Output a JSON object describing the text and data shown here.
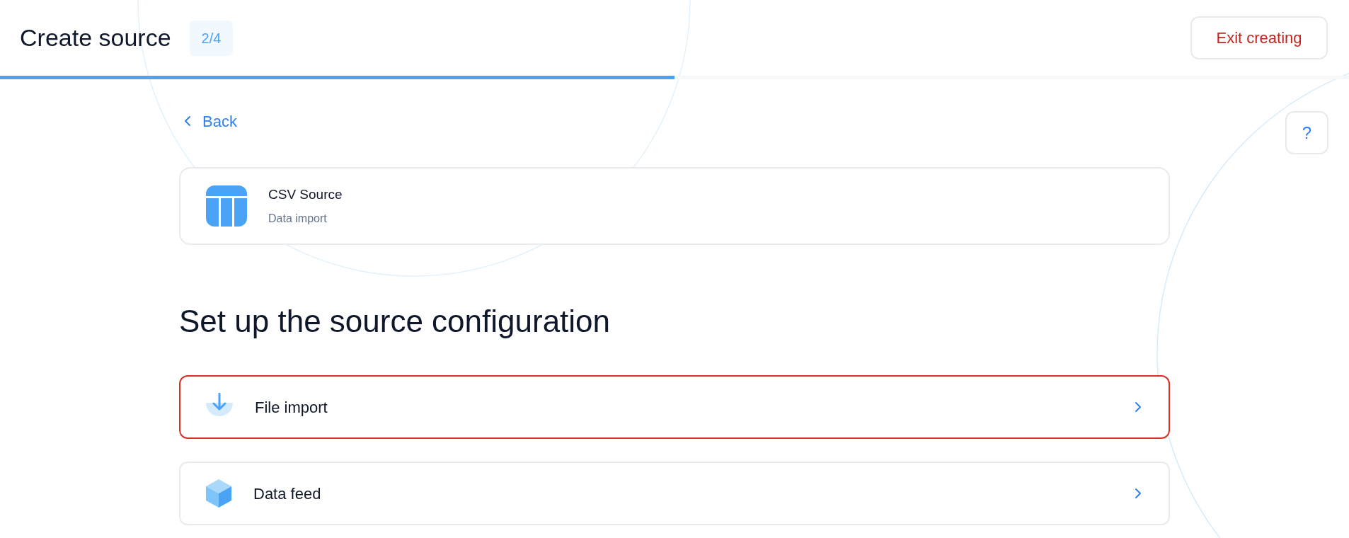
{
  "header": {
    "title": "Create source",
    "step": "2/4",
    "progress": {
      "level": 0.5
    },
    "exit_button": "Exit creating"
  },
  "back_link": "Back",
  "help_button": "?",
  "source": {
    "name": "CSV Source",
    "subtitle": "Data import"
  },
  "heading": "Set up the source configuration",
  "options": [
    {
      "kind": "file",
      "label": "File import",
      "selected": true
    },
    {
      "kind": "feed",
      "label": "Data feed",
      "selected": false
    }
  ]
}
